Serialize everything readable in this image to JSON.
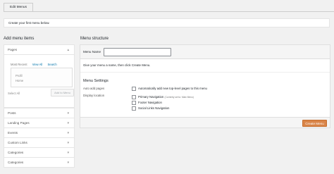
{
  "tab": {
    "label": "Edit Menus"
  },
  "notice": {
    "text": "Create your first menu below."
  },
  "left": {
    "title": "Add menu items",
    "pages": {
      "label": "Pages",
      "tabs": [
        "Most Recent",
        "View All",
        "Search"
      ],
      "items": [
        "Profil",
        "Home"
      ],
      "select_all": "Select All",
      "add_button": "Add to Menu"
    },
    "accordion": [
      "Posts",
      "Landing Pages",
      "Events",
      "Custom Links",
      "Categories",
      "Categories"
    ]
  },
  "right": {
    "title": "Menu structure",
    "menu_name_label": "Menu Name",
    "menu_name_value": "",
    "hint": "Give your menu a name, then click Create Menu.",
    "settings_title": "Menu Settings",
    "auto_add_label": "Auto add pages",
    "auto_add_option": "Automatically add new top-level pages to this menu",
    "display_label": "Display location",
    "locations": [
      {
        "name": "Primary Navigation",
        "note": "(Currently set to: Main Menu)"
      },
      {
        "name": "Footer Navigation",
        "note": ""
      },
      {
        "name": "Social Links Navigation",
        "note": ""
      }
    ],
    "create_button": "Create Menu"
  }
}
